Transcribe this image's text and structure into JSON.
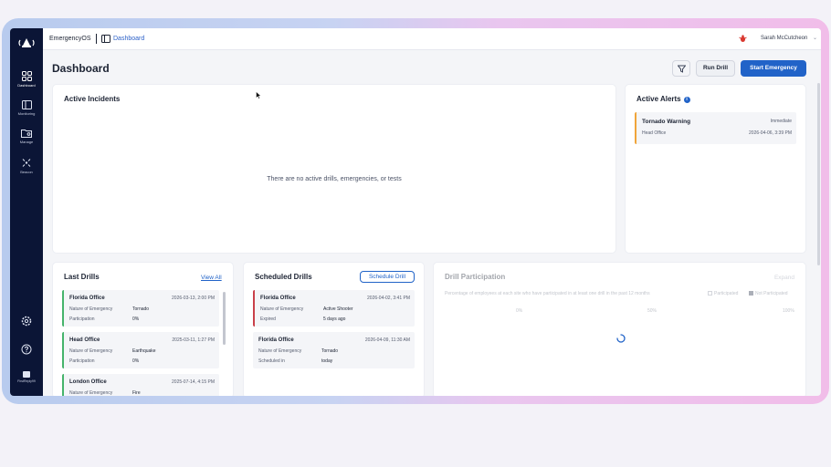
{
  "topbar": {
    "app_name": "EmergencyOS",
    "breadcrumb": "Dashboard",
    "user_name": "Sarah McCutcheon"
  },
  "sidebar": {
    "items": [
      {
        "label": "Dashboard",
        "icon": "dashboard-icon"
      },
      {
        "label": "Monitoring",
        "icon": "monitor-icon"
      },
      {
        "label": "Manage",
        "icon": "folder-icon"
      },
      {
        "label": "Beacon",
        "icon": "beacon-icon"
      }
    ],
    "bottom_logo_text": "FirstReply99"
  },
  "header": {
    "title": "Dashboard",
    "run_drill": "Run Drill",
    "start_emergency": "Start Emergency"
  },
  "active_incidents": {
    "title": "Active Incidents",
    "empty_message": "There are no active drills, emergencies, or tests"
  },
  "active_alerts": {
    "title": "Active Alerts",
    "items": [
      {
        "name": "Tornado Warning",
        "priority": "Immediate",
        "site": "Head Office",
        "time": "2026-04-06, 3:39 PM"
      }
    ]
  },
  "last_drills": {
    "title": "Last Drills",
    "view_all": "View All",
    "field_nature": "Nature of Emergency",
    "field_participation": "Participation",
    "items": [
      {
        "site": "Florida Office",
        "time": "2026-03-13, 2:00 PM",
        "nature": "Tornado",
        "participation": "0%"
      },
      {
        "site": "Head Office",
        "time": "2025-03-11, 1:27 PM",
        "nature": "Earthquake",
        "participation": "0%"
      },
      {
        "site": "London Office",
        "time": "2025-07-14, 4:15 PM",
        "nature": "Fire",
        "participation": ""
      }
    ]
  },
  "scheduled_drills": {
    "title": "Scheduled Drills",
    "schedule_button": "Schedule Drill",
    "field_nature": "Nature of Emergency",
    "items": [
      {
        "site": "Florida Office",
        "time": "2026-04-02, 3:41 PM",
        "nature": "Active Shooter",
        "status_label": "Expired",
        "status_value": "5 days ago"
      },
      {
        "site": "Florida Office",
        "time": "2026-04-09, 11:30 AM",
        "nature": "Tornado",
        "status_label": "Scheduled in",
        "status_value": "today"
      }
    ]
  },
  "drill_participation": {
    "title": "Drill Participation",
    "expand": "Expand",
    "subtitle": "Percentage of employees at each site who have participated in at least one drill in the past 12 months",
    "legend": [
      "Participated",
      "Not Participated"
    ],
    "ticks": [
      "0%",
      "50%",
      "100%"
    ]
  },
  "colors": {
    "sidebar": "#0b1536",
    "accent": "#2163c8",
    "alert_border": "#f0a53a",
    "drill_green": "#45b36b",
    "drill_red": "#c9404a"
  }
}
